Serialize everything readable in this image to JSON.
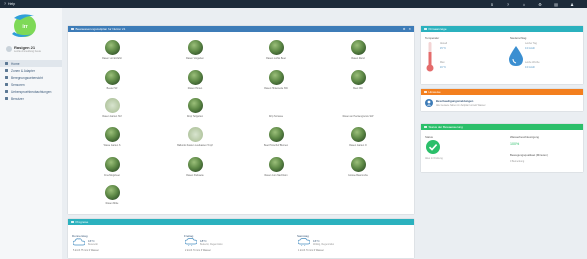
{
  "topbar": {
    "help_label": "Help",
    "icons": [
      "info-icon",
      "help-icon",
      "home-icon",
      "settings-icon",
      "tools-icon",
      "user-icon"
    ],
    "glyphs": [
      "ℹ",
      "?",
      "⌂",
      "⚙",
      "▤",
      "♟"
    ]
  },
  "sidebar": {
    "logo_text": "Irrigation",
    "user_name": "Rasigen 21",
    "user_sub": "Letzte Anmeldung heute",
    "nav": [
      {
        "label": "Home",
        "active": true
      },
      {
        "label": "Zonen & Adapter"
      },
      {
        "label": "Beregnungsuebersicht"
      },
      {
        "label": "Sensoren"
      },
      {
        "label": "Ueberspruehbeobachtungen"
      },
      {
        "label": "Benutzer"
      }
    ]
  },
  "sprinklers_panel": {
    "title": "Bewaesserungszeitplan fur Nutzer 21",
    "tools": [
      "⚙",
      "✕"
    ],
    "items": [
      {
        "name": "Rasen vor Einfahrt",
        "thumb": "dark"
      },
      {
        "name": "Rasen Vorgarten",
        "thumb": "dark"
      },
      {
        "name": "Rasen rechts Beet",
        "thumb": "dark"
      },
      {
        "name": "Rasen Rand",
        "thumb": "dark"
      },
      {
        "name": "Beete Hof",
        "thumb": "dark"
      },
      {
        "name": "Rasen Hinten",
        "thumb": "dark"
      },
      {
        "name": "Rasen Hinterseite SW",
        "thumb": "dark"
      },
      {
        "name": "Beet NW",
        "thumb": "dark"
      },
      {
        "name": "Rasen Garten Hof",
        "thumb": "light"
      },
      {
        "name": "Drop Teilgarten",
        "thumb": "dark"
      },
      {
        "name": "Drip Terrasse",
        "thumb": "none"
      },
      {
        "name": "Rasen an Heckengrenze SW",
        "thumb": "none"
      },
      {
        "name": "Wiese Garten S",
        "thumb": "dark"
      },
      {
        "name": "Balkonki Kasten Loetkasten Tropf",
        "thumb": "light"
      },
      {
        "name": "Beet Hinterhof Blumen",
        "thumb": "dark"
      },
      {
        "name": "Rasen Garten O",
        "thumb": "dark"
      },
      {
        "name": "Fruehlingsbeet",
        "thumb": "dark"
      },
      {
        "name": "Rasen Parkseite",
        "thumb": "dark"
      },
      {
        "name": "Rasen zum Nachbarn",
        "thumb": "dark"
      },
      {
        "name": "Grosse Baumreihe",
        "thumb": "dark"
      },
      {
        "name": "Rasen Mitte",
        "thumb": "dark"
      }
    ]
  },
  "forecast": {
    "title": "Prognose",
    "days": [
      {
        "title": "Donnerstag",
        "temp": "16°C",
        "desc": "Bewoelkt",
        "foot": "5 km/h   75 mm   0 Wasser"
      },
      {
        "title": "Freitag",
        "temp": "18°C",
        "desc": "Bedeckt, Regenrisiko",
        "foot": "2 km/h   74 mm   3 Wasser"
      },
      {
        "title": "Samstag",
        "temp": "16°C",
        "desc": "Wolkig, Regenrisiko",
        "foot": "1 km/h   74 mm   0 Wasser"
      }
    ]
  },
  "climate": {
    "title": "Klimaanzeige",
    "temp_label": "Temperatur",
    "temp_max_label": "Aktuell",
    "temp_max": "15 °C",
    "temp_min_label": "Max",
    "temp_min": "16 °C",
    "humidity_label": "Niederschlag",
    "humidity_top_label": "Letzter Tag",
    "humidity_top": "0.0 mm/h",
    "humidity_bottom_label": "Letzte Woche",
    "humidity_bottom": "0.0 mm/h"
  },
  "alerts": {
    "title": "Hinweise",
    "heading": "Beschaedigungsmeldungen",
    "text": "Alle Geraete haben im Zeitplan korrekt Wasser"
  },
  "status": {
    "title": "Status der Bewaesserung",
    "status_label": "Status",
    "status_value": "Alles in Ordnung",
    "efficiency_label": "Wasserbeschleunigung",
    "efficiency_value": "100%",
    "next_label": "Bewegungsqualitaet (Minuten)",
    "next_value": "0 Bemerkung",
    "accent": "#2bbf6a"
  },
  "colors": {
    "topbar": "#1d2b3a",
    "blue_header": "#3d7cb8",
    "teal_header": "#2bb1be",
    "orange_header": "#f37f1e",
    "green_header": "#2bbf6a"
  }
}
